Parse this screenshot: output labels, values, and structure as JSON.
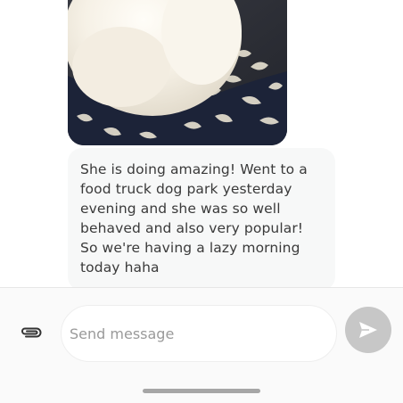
{
  "conversation": {
    "photo_message": {
      "image_subject": "white fluffy dog lying on a patterned navy and cream blanket"
    },
    "text_message": {
      "body": "She is doing amazing! Went to a\nfood truck dog park yesterday\nevening and she was so well\nbehaved and also very popular!\nSo we're having a lazy morning\ntoday haha"
    }
  },
  "composer": {
    "attach_icon": "paperclip-icon",
    "placeholder": "Send message",
    "value": "",
    "send_icon": "send-arrow-icon"
  },
  "colors": {
    "bubble_background": "#f7f8f8",
    "send_button_disabled": "#c7c7c7",
    "text": "#3a3a3a"
  }
}
